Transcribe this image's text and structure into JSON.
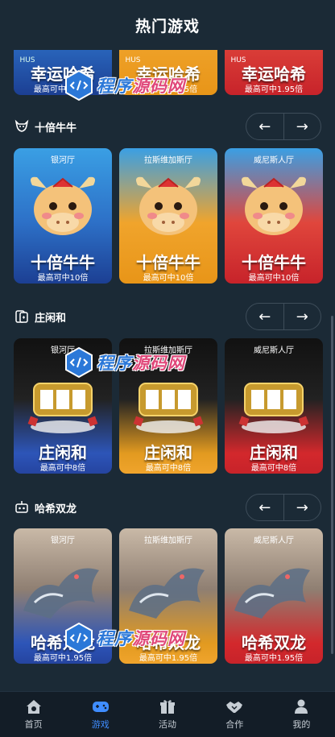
{
  "header": {
    "title": "热门游戏"
  },
  "top_row": {
    "cards": [
      {
        "name": "幸运哈希",
        "sub": "最高可中1.95倍",
        "label": "HUS"
      },
      {
        "name": "幸运哈希",
        "sub": "最高可中1.95倍",
        "label": "HUS"
      },
      {
        "name": "幸运哈希",
        "sub": "最高可中1.95倍",
        "label": "HUS"
      }
    ]
  },
  "sections": [
    {
      "title": "十倍牛牛",
      "icon": "bull-icon",
      "cards": [
        {
          "hall": "银河厅",
          "name": "十倍牛牛",
          "sub": "最高可中10倍"
        },
        {
          "hall": "拉斯维加斯厅",
          "name": "十倍牛牛",
          "sub": "最高可中10倍"
        },
        {
          "hall": "威尼斯人厅",
          "name": "十倍牛牛",
          "sub": "最高可中10倍"
        }
      ]
    },
    {
      "title": "庄闲和",
      "icon": "playing-cards-icon",
      "cards": [
        {
          "hall": "银河厅",
          "name": "庄闲和",
          "sub": "最高可中8倍"
        },
        {
          "hall": "拉斯维加斯厅",
          "name": "庄闲和",
          "sub": "最高可中8倍"
        },
        {
          "hall": "威尼斯人厅",
          "name": "庄闲和",
          "sub": "最高可中8倍"
        }
      ]
    },
    {
      "title": "哈希双龙",
      "icon": "robot-icon",
      "cards": [
        {
          "hall": "银河厅",
          "name": "哈希双龙",
          "sub": "最高可中1.95倍"
        },
        {
          "hall": "拉斯维加斯厅",
          "name": "哈希双龙",
          "sub": "最高可中1.95倍"
        },
        {
          "hall": "威尼斯人厅",
          "name": "哈希双龙",
          "sub": "最高可中1.95倍"
        }
      ]
    }
  ],
  "nav": {
    "prev": "←",
    "next": "→"
  },
  "watermark": {
    "text_a": "程序",
    "text_b": "源码网"
  },
  "tabbar": {
    "items": [
      {
        "label": "首页",
        "icon": "home-icon"
      },
      {
        "label": "游戏",
        "icon": "gamepad-icon",
        "active": true
      },
      {
        "label": "活动",
        "icon": "gift-icon"
      },
      {
        "label": "合作",
        "icon": "handshake-icon"
      },
      {
        "label": "我的",
        "icon": "user-icon"
      }
    ]
  },
  "colors": {
    "bg": "#1b2a36",
    "active": "#3f8dff",
    "blue": "#2d55b8",
    "gold": "#f0a42c",
    "red": "#c7232a"
  }
}
